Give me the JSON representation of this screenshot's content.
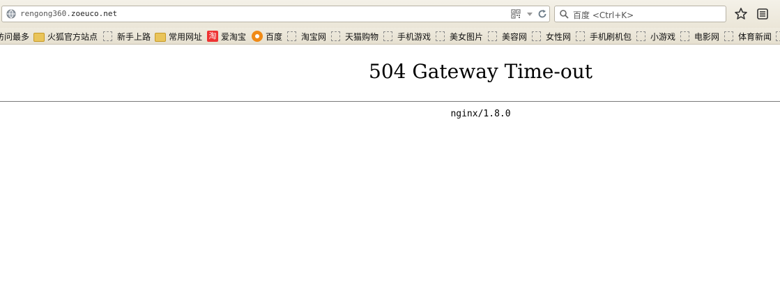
{
  "navigation": {
    "url_prefix": "rengong360.",
    "url_domain": "zoeuco.net",
    "search_placeholder": "百度 <Ctrl+K>"
  },
  "bookmarks": [
    {
      "label": "访问最多",
      "icon": "none"
    },
    {
      "label": "火狐官方站点",
      "icon": "folder-icon"
    },
    {
      "label": "新手上路",
      "icon": "page-icon"
    },
    {
      "label": "常用网址",
      "icon": "folder-icon"
    },
    {
      "label": "爱淘宝",
      "icon": "taobao-icon"
    },
    {
      "label": "百度",
      "icon": "baidu-icon"
    },
    {
      "label": "淘宝网",
      "icon": "page-icon"
    },
    {
      "label": "天猫购物",
      "icon": "page-icon"
    },
    {
      "label": "手机游戏",
      "icon": "page-icon"
    },
    {
      "label": "美女图片",
      "icon": "page-icon"
    },
    {
      "label": "美容网",
      "icon": "page-icon"
    },
    {
      "label": "女性网",
      "icon": "page-icon"
    },
    {
      "label": "手机刷机包",
      "icon": "page-icon"
    },
    {
      "label": "小游戏",
      "icon": "page-icon"
    },
    {
      "label": "电影网",
      "icon": "page-icon"
    },
    {
      "label": "体育新闻",
      "icon": "page-icon"
    }
  ],
  "taobao_glyph": "淘",
  "page": {
    "title": "504 Gateway Time-out",
    "server": "nginx/1.8.0"
  },
  "colors": {
    "toolbar_bg": "#ebe6d8",
    "text": "#000000"
  }
}
